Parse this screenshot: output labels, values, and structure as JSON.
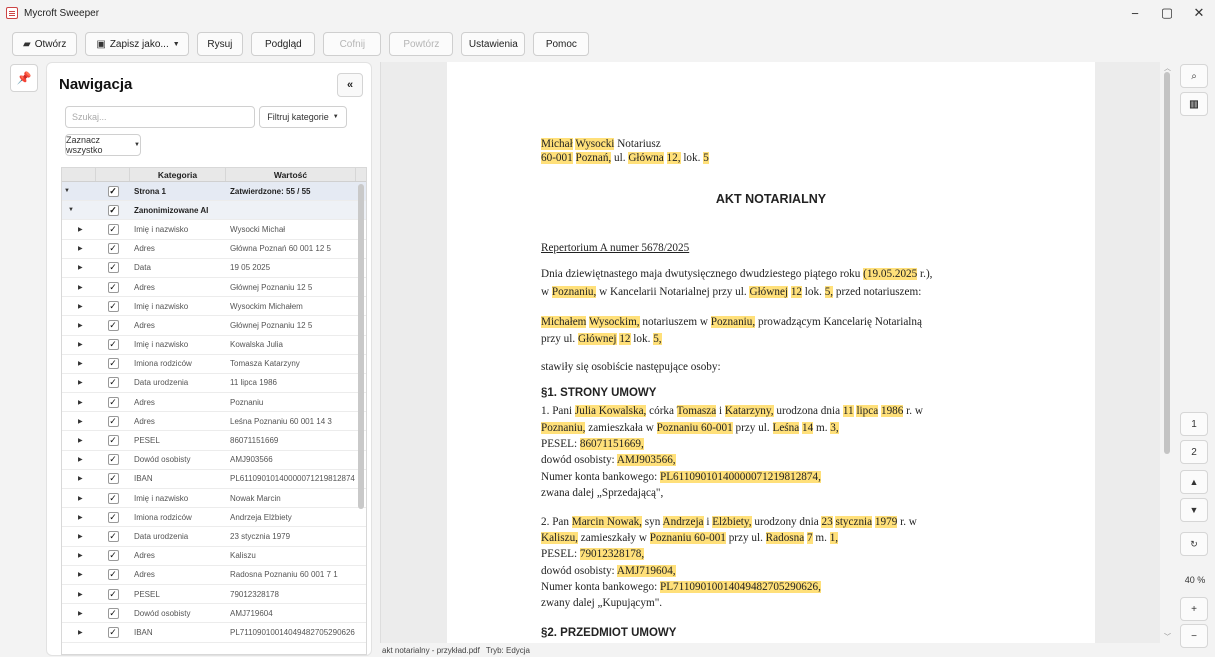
{
  "window": {
    "title": "Mycroft Sweeper",
    "controls": {
      "minimize": "−",
      "maximize": "▢",
      "close": "✕"
    }
  },
  "toolbar": {
    "open": "Otwórz",
    "save_as": "Zapisz jako...",
    "draw": "Rysuj",
    "preview": "Podgląd",
    "undo": "Cofnij",
    "redo": "Powtórz",
    "settings": "Ustawienia",
    "help": "Pomoc"
  },
  "nav": {
    "title": "Nawigacja",
    "search_placeholder": "Szukaj...",
    "filter_label": "Filtruj kategorie",
    "select_all_label": "Zaznacz wszystko",
    "columns": {
      "category": "Kategoria",
      "value": "Wartość"
    },
    "group": {
      "category": "Strona 1",
      "value": "Zatwierdzone: 55 / 55"
    },
    "subgroup": {
      "category": "Zanonimizowane AI"
    },
    "rows": [
      {
        "category": "Imię i nazwisko",
        "value": "Wysocki Michał"
      },
      {
        "category": "Adres",
        "value": "Główna Poznań 60 001 12 5"
      },
      {
        "category": "Data",
        "value": "19 05 2025"
      },
      {
        "category": "Adres",
        "value": "Głównej Poznaniu 12 5"
      },
      {
        "category": "Imię i nazwisko",
        "value": "Wysockim Michałem"
      },
      {
        "category": "Adres",
        "value": "Głównej Poznaniu 12 5"
      },
      {
        "category": "Imię i nazwisko",
        "value": "Kowalska Julia"
      },
      {
        "category": "Imiona rodziców",
        "value": "Tomasza Katarzyny"
      },
      {
        "category": "Data urodzenia",
        "value": "11 lipca 1986"
      },
      {
        "category": "Adres",
        "value": "Poznaniu"
      },
      {
        "category": "Adres",
        "value": "Leśna Poznaniu 60 001 14 3"
      },
      {
        "category": "PESEL",
        "value": "86071151669"
      },
      {
        "category": "Dowód osobisty",
        "value": "AMJ903566"
      },
      {
        "category": "IBAN",
        "value": "PL61109010140000071219812874"
      },
      {
        "category": "Imię i nazwisko",
        "value": "Nowak Marcin"
      },
      {
        "category": "Imiona rodziców",
        "value": "Andrzeja Elżbiety"
      },
      {
        "category": "Data urodzenia",
        "value": "23 stycznia 1979"
      },
      {
        "category": "Adres",
        "value": "Kaliszu"
      },
      {
        "category": "Adres",
        "value": "Radosna Poznaniu 60 001 7 1"
      },
      {
        "category": "PESEL",
        "value": "79012328178"
      },
      {
        "category": "Dowód osobisty",
        "value": "AMJ719604"
      },
      {
        "category": "IBAN",
        "value": "PL71109010014049482705290626"
      }
    ]
  },
  "doc": {
    "header_name": "Michał",
    "header_name2": "Wysocki",
    "header_role": " Notariusz",
    "header_zip": "60-001",
    "header_city": "Poznań,",
    "header_street_pre": " ul. ",
    "header_street": "Główna",
    "header_no": "12,",
    "header_lok_pre": " lok. ",
    "header_lok": "5",
    "title": "AKT NOTARIALNY",
    "repertorium": "Repertorium A numer 5678/2025",
    "p1_a": "Dnia dziewiętnastego maja dwutysięcznego dwudziestego piątego roku ",
    "p1_date": "(19.05.2025",
    "p1_b": " r.),",
    "p1_c": "w ",
    "p1_city": "Poznaniu,",
    "p1_d": " w Kancelarii Notarialnej przy ul. ",
    "p1_street": "Głównej",
    "p1_no": "12",
    "p1_e": " lok. ",
    "p1_lok": "5,",
    "p1_f": " przed notariuszem:",
    "p2_name": "Michałem",
    "p2_surname": "Wysockim,",
    "p2_a": " notariuszem w ",
    "p2_city": "Poznaniu,",
    "p2_b": " prowadzącym Kancelarię Notarialną",
    "p2_c": "przy ul. ",
    "p2_street": "Głównej",
    "p2_no": "12",
    "p2_d": " lok. ",
    "p2_lok": "5,",
    "p3": "stawiły się osobiście następujące osoby:",
    "sec1": "§1. STRONY UMOWY",
    "s1_a": "1. Pani ",
    "s1_name": "Julia Kowalska,",
    "s1_b": " córka ",
    "s1_father": "Tomasza",
    "s1_c": " i ",
    "s1_mother": "Katarzyny,",
    "s1_d": " urodzona dnia ",
    "s1_day": "11",
    "s1_month": "lipca",
    "s1_year": "1986",
    "s1_e": " r. w",
    "s1_city": "Poznaniu,",
    "s1_f": " zamieszkała w ",
    "s1_city2": "Poznaniu 60-001",
    "s1_g": " przy ul. ",
    "s1_street": "Leśna",
    "s1_no": "14",
    "s1_h": " m. ",
    "s1_m": "3,",
    "s1_pesel_l": "PESEL: ",
    "s1_pesel": "86071151669,",
    "s1_id_l": "dowód osobisty: ",
    "s1_id": "AMJ903566,",
    "s1_acc_l": "Numer konta bankowego: ",
    "s1_acc": "PL61109010140000071219812874,",
    "s1_called": "zwana dalej „Sprzedającą\",",
    "s2_a": "2. Pan ",
    "s2_name": "Marcin Nowak,",
    "s2_b": " syn ",
    "s2_father": "Andrzeja",
    "s2_c": " i ",
    "s2_mother": "Elżbiety,",
    "s2_d": " urodzony dnia ",
    "s2_day": "23",
    "s2_month": "stycznia",
    "s2_year": "1979",
    "s2_e": " r. w",
    "s2_city": "Kaliszu,",
    "s2_f": " zamieszkały w ",
    "s2_city2": "Poznaniu 60-001",
    "s2_g": " przy ul. ",
    "s2_street": "Radosna",
    "s2_no": "7",
    "s2_h": " m. ",
    "s2_m": "1,",
    "s2_pesel_l": "PESEL: ",
    "s2_pesel": "79012328178,",
    "s2_id_l": "dowód osobisty: ",
    "s2_id": "AMJ719604,",
    "s2_acc_l": "Numer konta bankowego: ",
    "s2_acc": "PL71109010014049482705290626,",
    "s2_called": "zwany dalej „Kupującym\".",
    "sec2": "§2. PRZEDMIOT UMOWY"
  },
  "status": {
    "file": "akt notarialny - przykład.pdf",
    "mode": "Tryb: Edycja"
  },
  "right": {
    "page1": "1",
    "page2": "2",
    "zoom": "40 %",
    "zoom_in": "+",
    "zoom_out": "−"
  },
  "colors": {
    "highlight": "#ffe07a",
    "group_row": "#e5eaf3"
  }
}
